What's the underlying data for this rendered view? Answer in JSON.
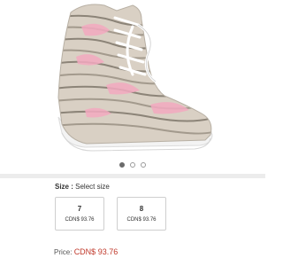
{
  "product": {
    "image_alt": "Patterned lace-up boot",
    "carousel": {
      "count": 3,
      "active": 0
    }
  },
  "size_selector": {
    "label": "Size :",
    "value": "Select size",
    "options": [
      {
        "size": "7",
        "price": "CDN$ 93.76"
      },
      {
        "size": "8",
        "price": "CDN$ 93.76"
      }
    ]
  },
  "price": {
    "label": "Price:",
    "value": "CDN$ 93.76"
  },
  "colors": {
    "price": "#c0392b",
    "divider": "#ececec",
    "boot_base": "#d9d0c4",
    "boot_pink": "#f2a9bf",
    "sole": "#f3f3f3"
  }
}
